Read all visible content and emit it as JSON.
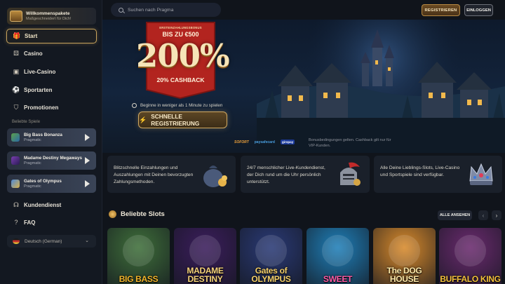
{
  "sidebar": {
    "welcome": {
      "title": "Willkommenspakete",
      "subtitle": "Maßgeschneidert für Dich!"
    },
    "start_label": "Start",
    "nav": [
      {
        "label": "Casino",
        "icon": "dice-icon"
      },
      {
        "label": "Live-Casino",
        "icon": "live-cards-icon"
      },
      {
        "label": "Sportarten",
        "icon": "soccer-ball-icon"
      },
      {
        "label": "Promotionen",
        "icon": "shield-promo-icon"
      }
    ],
    "popular_label": "Beliebte Spiele",
    "popular_games": [
      {
        "name": "Big Bass Bonanza",
        "provider": "Pragmatic"
      },
      {
        "name": "Madame Destiny Megaways",
        "provider": "Pragmatic"
      },
      {
        "name": "Gates of Olympus",
        "provider": "Pragmatic"
      }
    ],
    "support_label": "Kundendienst",
    "faq_label": "FAQ",
    "language": "Deutsch (German)"
  },
  "topbar": {
    "search_placeholder": "Suchen nach Pragma",
    "register_label": "REGISTRIEREN",
    "login_label": "EINLOGGEN"
  },
  "hero": {
    "bonus_title": "ERSTEINZAHLUNGSBONUS",
    "bonus_upto": "BIS ZU €500",
    "bonus_percent": "200%",
    "bonus_cashback": "20% CASHBACK",
    "timer_text": "Beginne in weniger als 1 Minute zu spielen",
    "quick_register_label": "SCHNELLE REGISTRIERUNG",
    "payments": [
      "SOFORT",
      "paysafecard",
      "giropay"
    ],
    "terms_text": "Bonusbedingungen gelten. Cashback gilt nur für VIP-Kunden."
  },
  "features": [
    {
      "text": "Blitzschnelle Einzahlungen und Auszahlungen mit Deinen bevorzugten Zahlungsmethoden."
    },
    {
      "text": "24/7 menschlicher Live-Kundendienst, der Dich rund um die Uhr persönlich unterstützt."
    },
    {
      "text": "Alle Deine Lieblings-Slots, Live-Casino und Sportspiele sind verfügbar."
    }
  ],
  "slots": {
    "title": "Beliebte Slots",
    "view_all_label": "ALLE ANSEHEN",
    "games": [
      {
        "title": "BIG BASS",
        "bg": "#3f6f3a",
        "color": "#f2b52a"
      },
      {
        "title": "MADAME DESTINY",
        "bg": "#3b1d5c",
        "color": "#f5d27a"
      },
      {
        "title": "Gates of OLYMPUS",
        "bg": "#2a3a76",
        "color": "#f3cf6b"
      },
      {
        "title": "SWEET",
        "bg": "#1f7fb8",
        "color": "#ff5aa5"
      },
      {
        "title": "The DOG HOUSE",
        "bg": "#d88a2c",
        "color": "#ffe9a8"
      },
      {
        "title": "BUFFALO KING",
        "bg": "#6a2a6e",
        "color": "#f4c13a"
      }
    ]
  },
  "colors": {
    "accent_gold": "#c9a45c",
    "background": "#10141b",
    "sidebar": "#131821"
  }
}
